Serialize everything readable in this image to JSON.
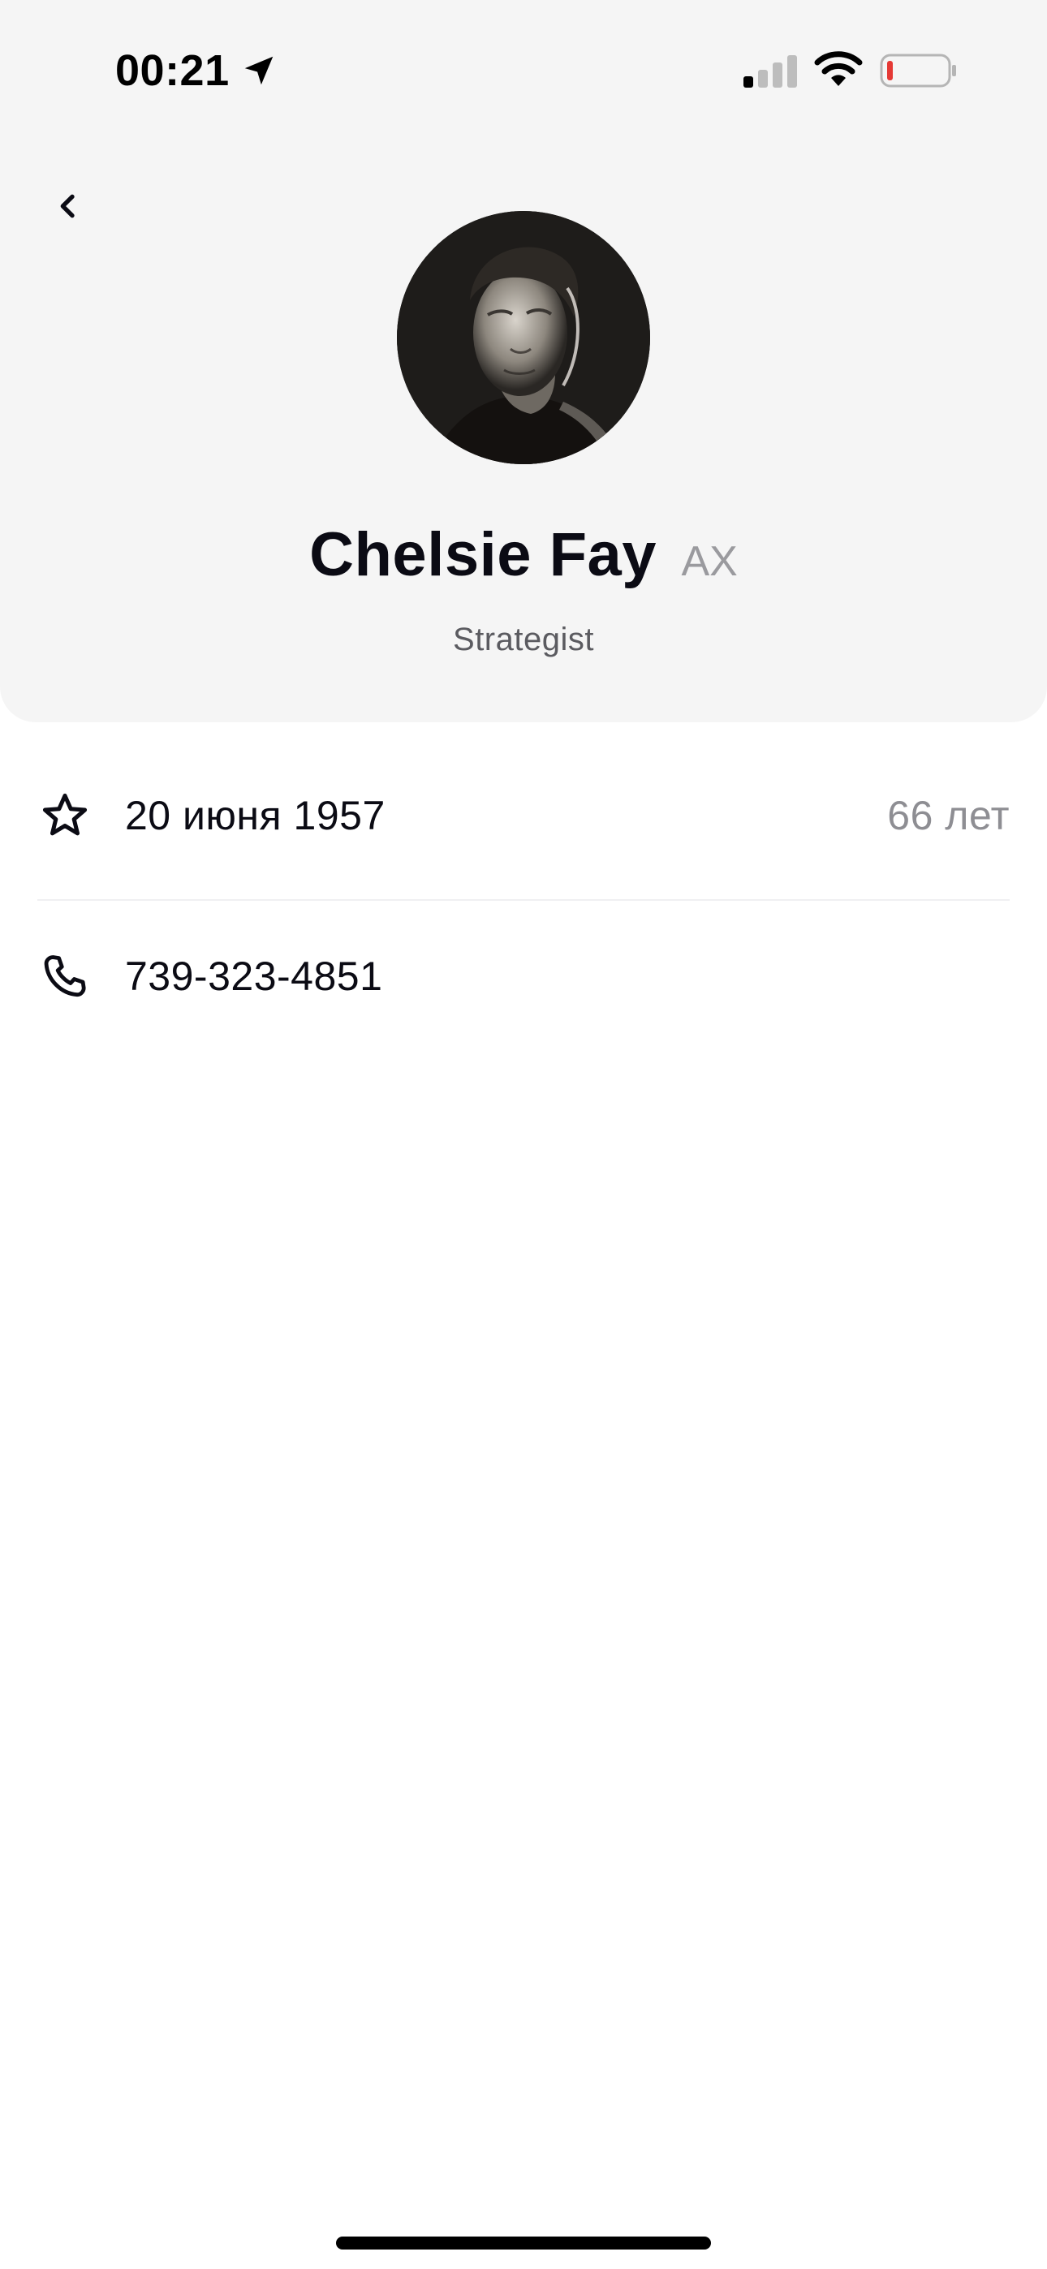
{
  "status_bar": {
    "time": "00:21",
    "battery_color": "#e53935"
  },
  "header": {
    "back_icon": "chevron-left-icon",
    "avatar_icon": "person-portrait",
    "name": "Chelsie Fay",
    "initials": "AX",
    "role": "Strategist"
  },
  "details": {
    "birthday": {
      "icon": "star-icon",
      "date": "20 июня 1957",
      "age": "66 лет"
    },
    "phone": {
      "icon": "phone-icon",
      "number": "739-323-4851"
    }
  },
  "colors": {
    "header_background": "#f5f5f5",
    "text_primary": "#0b0b14",
    "text_secondary": "#8e8e93"
  }
}
